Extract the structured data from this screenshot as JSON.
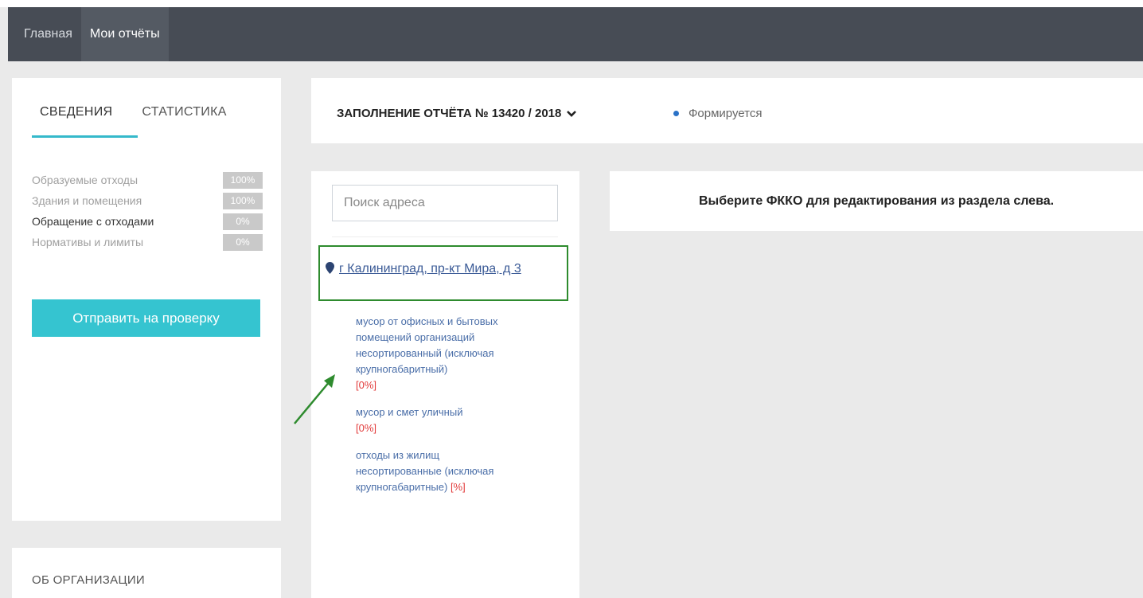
{
  "nav": {
    "items": [
      {
        "label": "Главная",
        "active": false
      },
      {
        "label": "Мои отчёты",
        "active": true
      }
    ]
  },
  "left_panel": {
    "tabs": [
      {
        "label": "СВЕДЕНИЯ",
        "active": true
      },
      {
        "label": "СТАТИСТИКА",
        "active": false
      }
    ],
    "sections": [
      {
        "label": "Образуемые отходы",
        "percent": "100%"
      },
      {
        "label": "Здания и помещения",
        "percent": "100%"
      },
      {
        "label": "Обращение с отходами",
        "percent": "0%",
        "current": true
      },
      {
        "label": "Нормативы и лимиты",
        "percent": "0%"
      }
    ],
    "send_button": "Отправить на проверку"
  },
  "organization": {
    "title": "ОБ ОРГАНИЗАЦИИ"
  },
  "header": {
    "report_title": "ЗАПОЛНЕНИЕ ОТЧЁТА № 13420 / 2018",
    "status": "Формируется",
    "status_color": "#2a72c7"
  },
  "address_panel": {
    "search_placeholder": "Поиск адреса",
    "address": "г Калининград, пр-кт Мира, д 3",
    "fkko": [
      {
        "name": "мусор от офисных и бытовых помещений организаций несортированный (исключая крупногабаритный)",
        "percent": "[0%]"
      },
      {
        "name": "мусор и смет уличный",
        "percent": "[0%]"
      },
      {
        "name": "отходы из жилищ несортированные (исключая крупногабаритные)",
        "percent": "[%]"
      }
    ]
  },
  "editor": {
    "hint": "Выберите ФККО для редактирования из раздела слева."
  },
  "colors": {
    "accent": "#35c4d0",
    "highlight_box": "#2e8b2e",
    "navbar": "#474c55",
    "percent_red": "#e23b3b"
  }
}
